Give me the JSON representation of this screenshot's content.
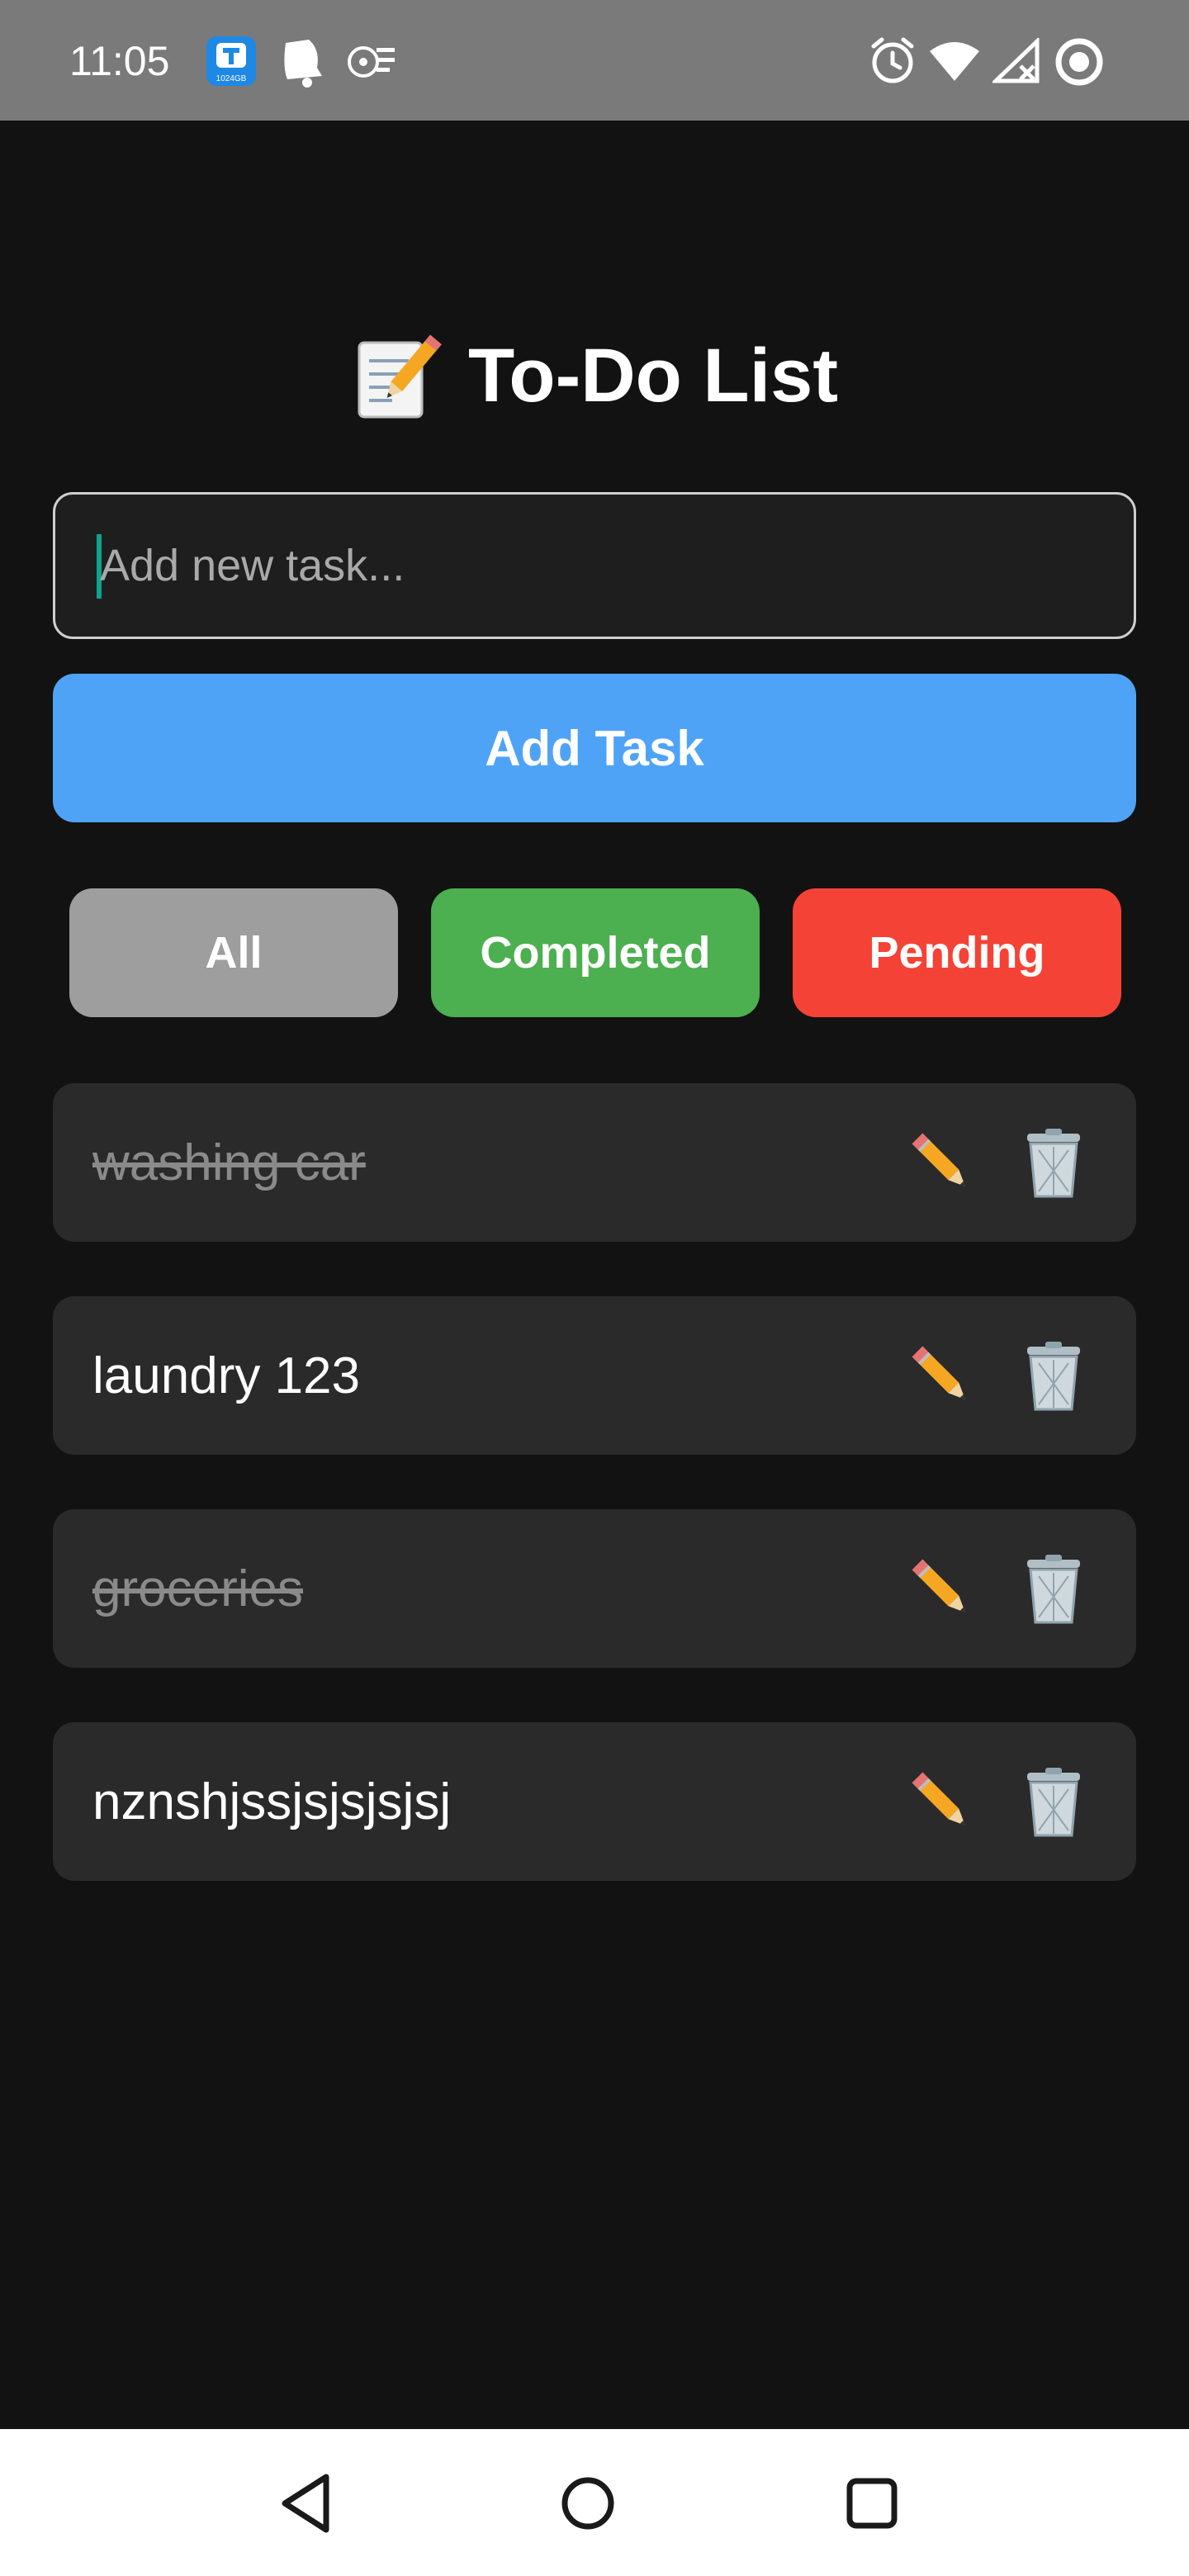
{
  "status_bar": {
    "time": "11:05",
    "app_badge_text": "1024GB",
    "icons": [
      "app-1024gb-icon",
      "bell-notification-icon",
      "fan-icon",
      "alarm-icon",
      "wifi-icon",
      "signal-icon",
      "data-saver-icon"
    ]
  },
  "header": {
    "title": "To-Do List",
    "title_icon": "memo-pencil-icon"
  },
  "input": {
    "placeholder": "Add new task...",
    "value": ""
  },
  "add_button": {
    "label": "Add Task"
  },
  "filters": [
    {
      "label": "All",
      "color": "#9e9e9e"
    },
    {
      "label": "Completed",
      "color": "#4caf50"
    },
    {
      "label": "Pending",
      "color": "#f44336"
    }
  ],
  "tasks": [
    {
      "text": "washing car",
      "completed": true
    },
    {
      "text": "laundry 123",
      "completed": false
    },
    {
      "text": "groceries",
      "completed": true
    },
    {
      "text": "nznshjssjsjsjsjsj",
      "completed": false
    }
  ],
  "colors": {
    "background": "#121212",
    "accent": "#4fa3f7",
    "task_background": "#2a2a2a"
  },
  "nav_bar": {
    "icons": [
      "back-icon",
      "home-icon",
      "recents-icon"
    ]
  }
}
